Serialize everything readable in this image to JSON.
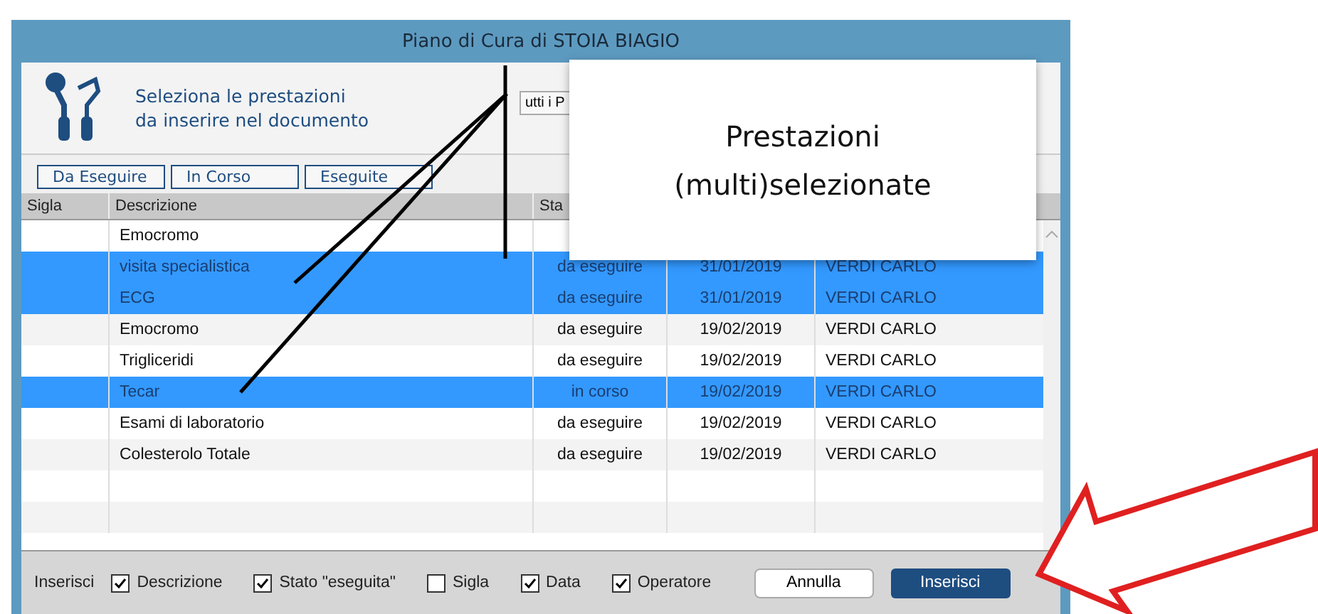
{
  "window": {
    "title": "Piano di Cura di STOIA BIAGIO"
  },
  "header": {
    "lines": [
      "Seleziona le prestazioni",
      "da inserire nel documento"
    ],
    "filter_dropdown": "utti i P"
  },
  "filter_buttons": [
    "Da Eseguire",
    "In Corso",
    "Eseguite"
  ],
  "table": {
    "columns": [
      "Sigla",
      "Descrizione",
      "Sta"
    ],
    "rows": [
      {
        "descrizione": "Emocromo",
        "selected": false
      },
      {
        "descrizione": "visita specialistica",
        "stato": "da eseguire",
        "data": "31/01/2019",
        "operatore": "VERDI CARLO",
        "selected": true
      },
      {
        "descrizione": "ECG",
        "stato": "da eseguire",
        "data": "31/01/2019",
        "operatore": "VERDI CARLO",
        "selected": true
      },
      {
        "descrizione": "Emocromo",
        "stato": "da eseguire",
        "data": "19/02/2019",
        "operatore": "VERDI CARLO",
        "selected": false
      },
      {
        "descrizione": "Trigliceridi",
        "stato": "da eseguire",
        "data": "19/02/2019",
        "operatore": "VERDI CARLO",
        "selected": false
      },
      {
        "descrizione": "Tecar",
        "stato": "in corso",
        "data": "19/02/2019",
        "operatore": "VERDI CARLO",
        "selected": true
      },
      {
        "descrizione": "Esami di laboratorio",
        "stato": "da eseguire",
        "data": "19/02/2019",
        "operatore": "VERDI CARLO",
        "selected": false
      },
      {
        "descrizione": "Colesterolo Totale",
        "stato": "da eseguire",
        "data": "19/02/2019",
        "operatore": "VERDI CARLO",
        "selected": false
      }
    ]
  },
  "footer": {
    "label": "Inserisci",
    "options": [
      {
        "label": "Descrizione",
        "checked": true
      },
      {
        "label": "Stato \"eseguita\"",
        "checked": true
      },
      {
        "label": "Sigla",
        "checked": false
      },
      {
        "label": "Data",
        "checked": true
      },
      {
        "label": "Operatore",
        "checked": true
      }
    ],
    "cancel": "Annulla",
    "confirm": "Inserisci"
  },
  "callout": {
    "lines": [
      "Prestazioni",
      "(multi)selezionate"
    ]
  }
}
